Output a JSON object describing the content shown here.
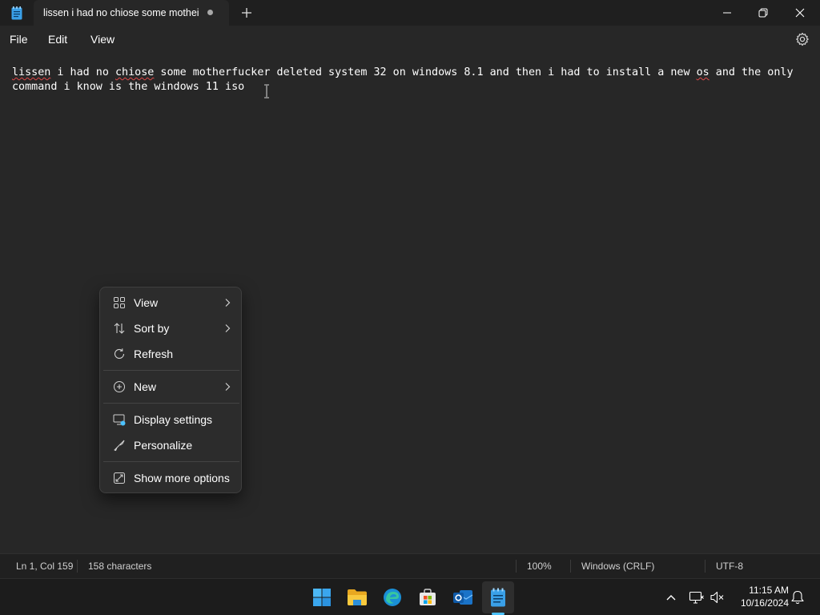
{
  "window": {
    "tab_title": "lissen i had no chiose some mothei",
    "app_icon": "notepad-icon"
  },
  "menu": {
    "file": "File",
    "edit": "Edit",
    "view": "View"
  },
  "document": {
    "seg1": "lissen",
    "seg2": " i had no ",
    "seg3": "chiose",
    "seg4": " some motherfucker deleted system 32 on windows 8.1 and then i had to install a new ",
    "seg5": "os",
    "seg6": " and the only command i know is the windows 11 iso"
  },
  "context_menu": {
    "items": [
      {
        "label": "View",
        "icon": "grid-icon",
        "submenu": true
      },
      {
        "label": "Sort by",
        "icon": "sort-icon",
        "submenu": true
      },
      {
        "label": "Refresh",
        "icon": "refresh-icon",
        "submenu": false
      },
      {
        "label": "New",
        "icon": "plus-circle-icon",
        "submenu": true
      },
      {
        "label": "Display settings",
        "icon": "display-icon",
        "submenu": false
      },
      {
        "label": "Personalize",
        "icon": "brush-icon",
        "submenu": false
      },
      {
        "label": "Show more options",
        "icon": "expand-icon",
        "submenu": false
      }
    ]
  },
  "status": {
    "position": "Ln 1, Col 159",
    "characters": "158 characters",
    "zoom": "100%",
    "line_ending": "Windows (CRLF)",
    "encoding": "UTF-8"
  },
  "taskbar": {
    "apps": [
      "windows-start-icon",
      "file-explorer-icon",
      "edge-icon",
      "store-icon",
      "outlook-icon",
      "notepad-icon"
    ],
    "time": "11:15 AM",
    "date": "10/16/2024"
  },
  "colors": {
    "background": "#272727",
    "titlebar": "#1f1f1f",
    "accent": "#4cc2ff",
    "spellcheck": "#e04848"
  }
}
